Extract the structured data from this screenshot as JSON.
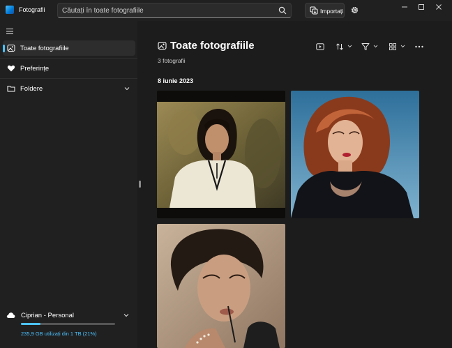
{
  "app": {
    "title": "Fotografii"
  },
  "search": {
    "placeholder": "Căutați în toate fotografiile"
  },
  "toolbar": {
    "import_label": "Importați"
  },
  "sidebar": {
    "items": [
      {
        "label": "Toate fotografiile",
        "icon": "photos-icon",
        "active": true
      },
      {
        "label": "Preferințe",
        "icon": "heart-icon"
      },
      {
        "label": "Foldere",
        "icon": "folder-icon"
      }
    ],
    "storage": {
      "account": "Ciprian - Personal",
      "usage_text": "235,9 GB utilizați din 1 TB (21%)",
      "used_fraction": 0.21
    }
  },
  "main": {
    "title": "Toate fotografiile",
    "count_text": "3 fotografii",
    "date_group": "8 iunie 2023",
    "tools": [
      "slideshow-icon",
      "sort-icon",
      "filter-icon",
      "view-grid-icon",
      "more-icon"
    ],
    "photos": [
      {
        "name": "photo-woman-white-blouse"
      },
      {
        "name": "photo-woman-red-hair"
      },
      {
        "name": "photo-woman-portrait"
      }
    ]
  },
  "colors": {
    "accent": "#4cc2ff",
    "background": "#1c1c1c",
    "sidebar": "#202020"
  }
}
